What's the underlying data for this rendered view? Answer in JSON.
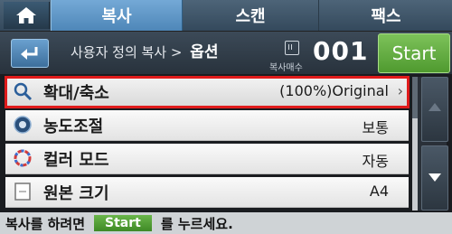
{
  "tabs": [
    {
      "label": "복사",
      "active": true
    },
    {
      "label": "스캔",
      "active": false
    },
    {
      "label": "팩스",
      "active": false
    }
  ],
  "header": {
    "breadcrumb_parent": "사용자 정의 복사 >",
    "breadcrumb_current": "옵션",
    "copies_label": "복사매수",
    "copies_value": "001",
    "start_label": "Start"
  },
  "menu_items": [
    {
      "label": "확대/축소",
      "value": "(100%)Original",
      "selected": true,
      "icon": "magnifier-icon"
    },
    {
      "label": "농도조절",
      "value": "보통",
      "selected": false,
      "icon": "darkness-icon"
    },
    {
      "label": "컬러 모드",
      "value": "자동",
      "selected": false,
      "icon": "color-mode-icon"
    },
    {
      "label": "원본 크기",
      "value": "A4",
      "selected": false,
      "icon": "original-size-icon"
    }
  ],
  "status": {
    "prefix": "복사를 하려면",
    "badge": "Start",
    "suffix": "를 누르세요."
  },
  "colors": {
    "accent_tab": "#5b95c6",
    "start_green": "#5ea63b",
    "selection_outline": "#e01b1b"
  }
}
